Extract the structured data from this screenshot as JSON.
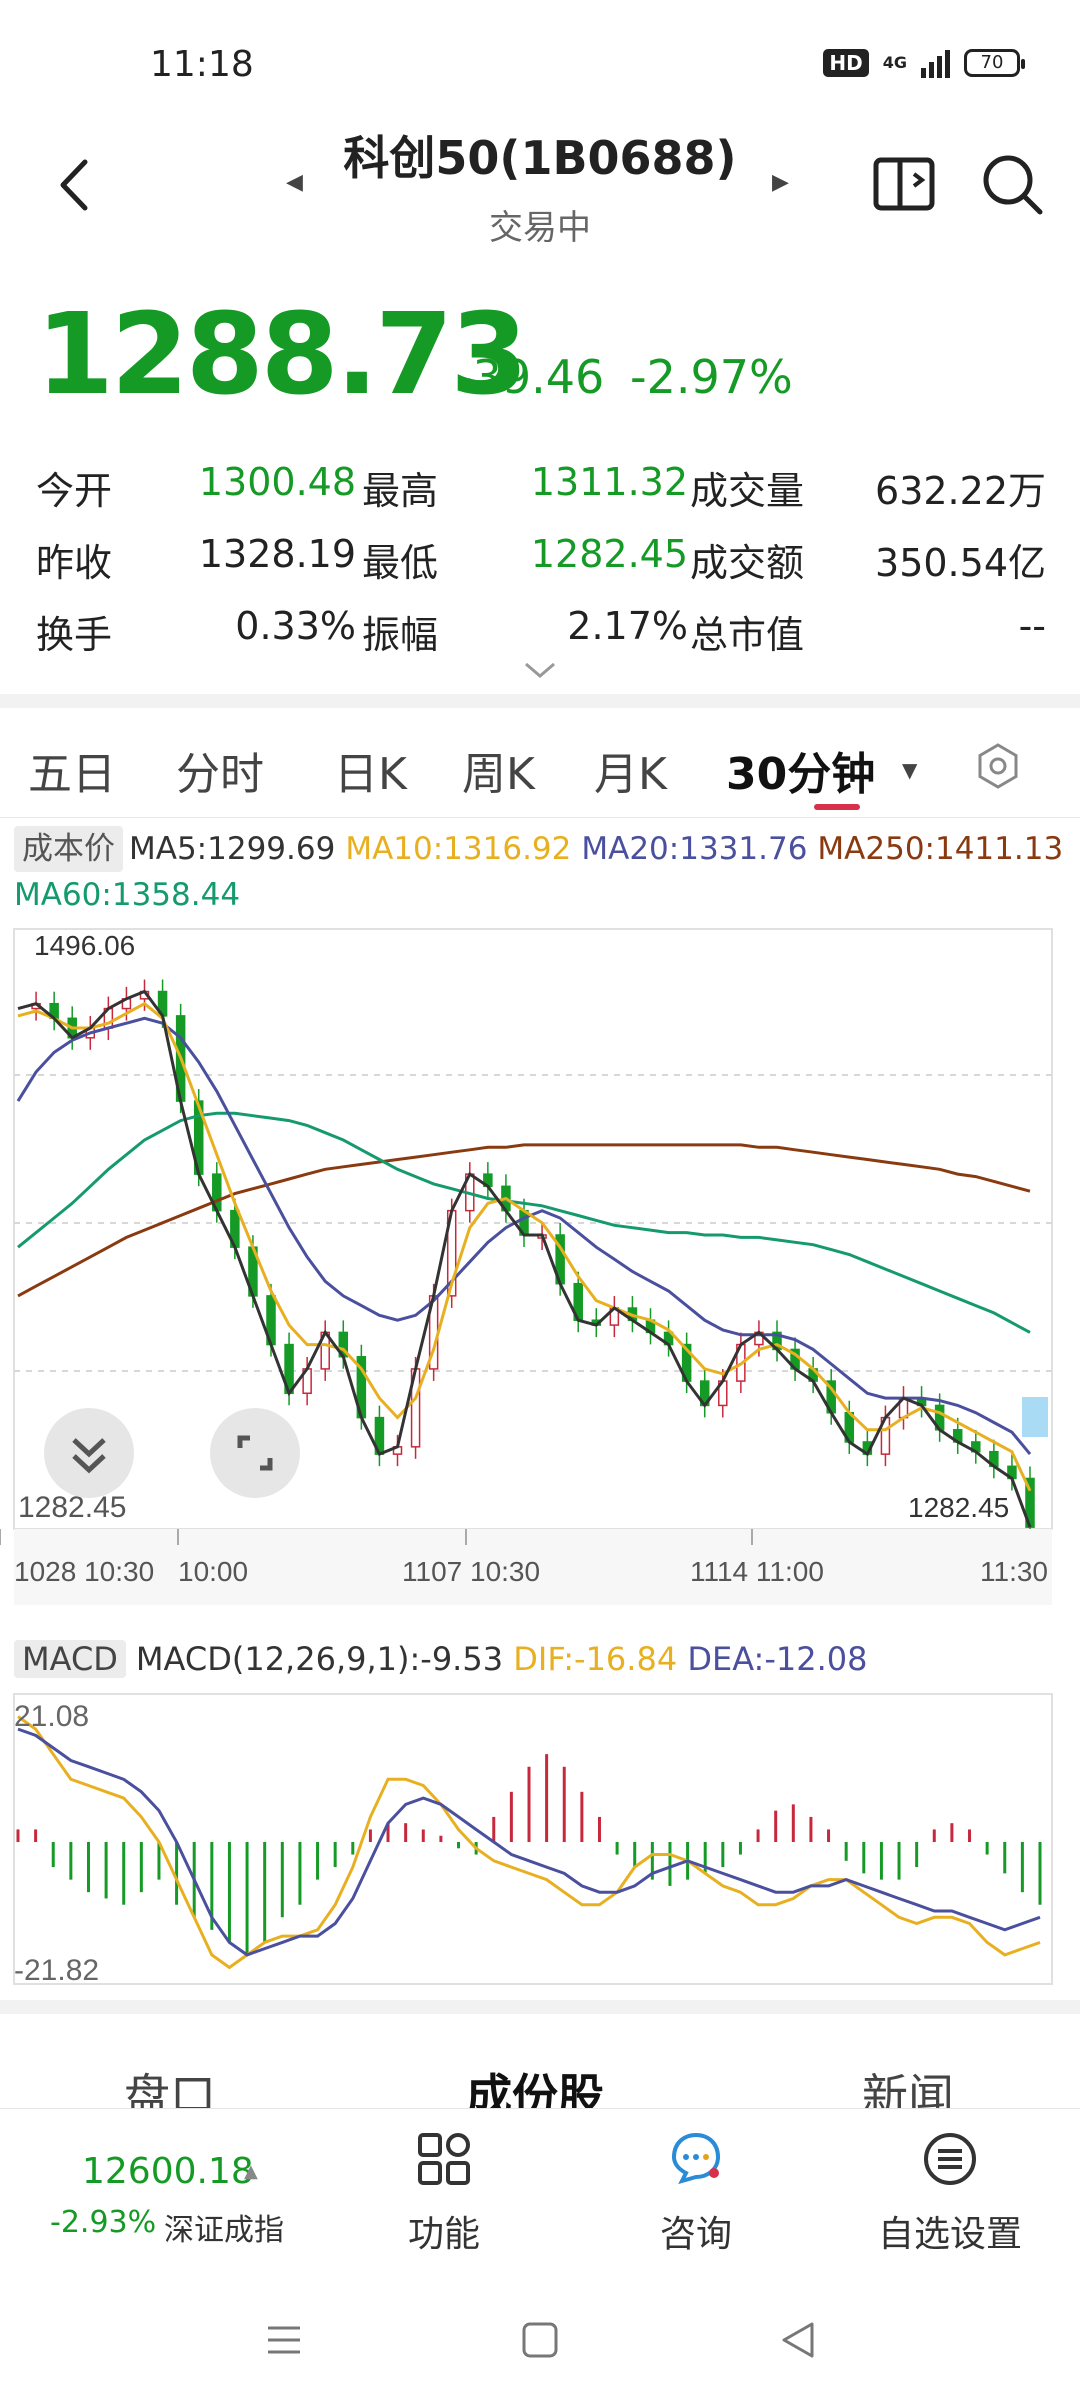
{
  "status_bar": {
    "time": "11:18",
    "hd": "HD",
    "network": "4G",
    "battery": "70"
  },
  "header": {
    "title": "科创50(1B0688)",
    "subtitle": "交易中"
  },
  "quote": {
    "price": "1288.73",
    "change": "-39.46",
    "change_pct": "-2.97%"
  },
  "stats": [
    {
      "l1": "今开",
      "v1": "1300.48",
      "l2": "最高",
      "v2": "1311.32",
      "l3": "成交量",
      "v3": "632.22万"
    },
    {
      "l1": "昨收",
      "v1": "1328.19",
      "l2": "最低",
      "v2": "1282.45",
      "l3": "成交额",
      "v3": "350.54亿"
    },
    {
      "l1": "换手",
      "v1": "0.33%",
      "l2": "振幅",
      "v2": "2.17%",
      "l3": "总市值",
      "v3": "--"
    }
  ],
  "tabs": [
    "五日",
    "分时",
    "日K",
    "周K",
    "月K",
    "30分钟"
  ],
  "legend": {
    "cost_label": "成本价",
    "ma5": "MA5:1299.69",
    "ma10": "MA10:1316.92",
    "ma20": "MA20:1331.76",
    "ma250": "MA250:1411.13",
    "ma60": "MA60:1358.44"
  },
  "colors": {
    "down": "#159a26",
    "up": "#c8283c",
    "ma5": "#333333",
    "ma10": "#e8b020",
    "ma20": "#4a4f9e",
    "ma60": "#159a6e",
    "ma250": "#8a3a10"
  },
  "chart_data": [
    {
      "type": "line",
      "title": "",
      "x_labels": [
        "1028 10:30",
        "10:00",
        "1107 10:30",
        "1114 11:00",
        "11:30"
      ],
      "max_label": "1496.06",
      "min_label": "1282.45",
      "left_low_label": "1282.45",
      "ylim": [
        1270,
        1500
      ],
      "series": [
        {
          "name": "MA5",
          "values": [
            1478,
            1480,
            1474,
            1466,
            1470,
            1478,
            1482,
            1485,
            1475,
            1440,
            1410,
            1395,
            1380,
            1360,
            1340,
            1320,
            1330,
            1345,
            1335,
            1310,
            1295,
            1298,
            1330,
            1360,
            1395,
            1410,
            1405,
            1395,
            1385,
            1385,
            1365,
            1350,
            1348,
            1355,
            1350,
            1345,
            1340,
            1325,
            1315,
            1325,
            1340,
            1345,
            1338,
            1330,
            1325,
            1312,
            1300,
            1295,
            1310,
            1318,
            1315,
            1305,
            1300,
            1296,
            1290,
            1285,
            1265
          ]
        },
        {
          "name": "MA10",
          "values": [
            1475,
            1477,
            1474,
            1470,
            1470,
            1472,
            1476,
            1480,
            1474,
            1458,
            1438,
            1418,
            1398,
            1380,
            1362,
            1348,
            1340,
            1340,
            1338,
            1330,
            1318,
            1310,
            1318,
            1338,
            1365,
            1388,
            1398,
            1400,
            1395,
            1390,
            1380,
            1368,
            1358,
            1355,
            1352,
            1350,
            1346,
            1338,
            1330,
            1328,
            1332,
            1338,
            1340,
            1336,
            1330,
            1322,
            1312,
            1305,
            1305,
            1310,
            1314,
            1312,
            1308,
            1304,
            1300,
            1296,
            1280
          ]
        },
        {
          "name": "MA20",
          "values": [
            1440,
            1452,
            1460,
            1465,
            1468,
            1470,
            1472,
            1474,
            1472,
            1466,
            1456,
            1444,
            1430,
            1416,
            1402,
            1388,
            1376,
            1366,
            1360,
            1356,
            1352,
            1350,
            1352,
            1358,
            1366,
            1374,
            1382,
            1388,
            1392,
            1395,
            1392,
            1386,
            1380,
            1375,
            1370,
            1366,
            1362,
            1356,
            1350,
            1346,
            1344,
            1344,
            1344,
            1342,
            1338,
            1332,
            1326,
            1320,
            1318,
            1318,
            1318,
            1317,
            1315,
            1312,
            1308,
            1304,
            1295
          ]
        },
        {
          "name": "MA60",
          "values": [
            1380,
            1386,
            1392,
            1398,
            1405,
            1412,
            1418,
            1424,
            1428,
            1432,
            1434,
            1435,
            1435,
            1434,
            1433,
            1432,
            1430,
            1427,
            1424,
            1420,
            1416,
            1412,
            1409,
            1406,
            1404,
            1402,
            1400,
            1399,
            1398,
            1397,
            1395,
            1393,
            1391,
            1389,
            1388,
            1387,
            1386,
            1386,
            1385,
            1385,
            1384,
            1384,
            1383,
            1382,
            1381,
            1379,
            1377,
            1374,
            1371,
            1368,
            1365,
            1362,
            1359,
            1356,
            1353,
            1349,
            1345
          ]
        },
        {
          "name": "MA250",
          "values": [
            1360,
            1364,
            1368,
            1372,
            1376,
            1380,
            1384,
            1387,
            1390,
            1393,
            1396,
            1399,
            1402,
            1404,
            1406,
            1408,
            1410,
            1412,
            1413,
            1414,
            1415,
            1416,
            1417,
            1418,
            1419,
            1420,
            1421,
            1421,
            1422,
            1422,
            1422,
            1422,
            1422,
            1422,
            1422,
            1422,
            1422,
            1422,
            1422,
            1422,
            1422,
            1421,
            1421,
            1420,
            1419,
            1418,
            1417,
            1416,
            1415,
            1414,
            1413,
            1412,
            1410,
            1409,
            1407,
            1405,
            1403
          ]
        }
      ]
    },
    {
      "type": "bar",
      "title": "",
      "y_top_label": "21.08",
      "y_bottom_label": "-21.82",
      "ylim": [
        -22,
        22
      ],
      "histogram": [
        2,
        2,
        -4,
        -6,
        -8,
        -9,
        -10,
        -8,
        -6,
        -10,
        -12,
        -14,
        -16,
        -18,
        -16,
        -12,
        -10,
        -6,
        -4,
        -2,
        2,
        3,
        3,
        2,
        1,
        -1,
        -2,
        4,
        8,
        12,
        14,
        12,
        8,
        4,
        -2,
        -4,
        -6,
        -7,
        -6,
        -5,
        -4,
        -2,
        2,
        5,
        6,
        4,
        2,
        -3,
        -5,
        -6,
        -6,
        -4,
        2,
        3,
        2,
        -2,
        -5,
        -8,
        -10
      ],
      "series": [
        {
          "name": "DIF",
          "values": [
            20,
            18,
            14,
            10,
            9,
            8,
            7,
            4,
            0,
            -6,
            -12,
            -18,
            -20,
            -18,
            -16,
            -15,
            -15,
            -14,
            -10,
            -4,
            4,
            10,
            10,
            9,
            6,
            2,
            -1,
            -3,
            -4,
            -5,
            -6,
            -8,
            -10,
            -10,
            -8,
            -4,
            -2,
            -2,
            -3,
            -5,
            -7,
            -8,
            -10,
            -10,
            -9,
            -7,
            -6,
            -6,
            -8,
            -10,
            -12,
            -13,
            -12,
            -12,
            -13,
            -16,
            -18,
            -17,
            -16
          ]
        },
        {
          "name": "DEA",
          "values": [
            18,
            17,
            15,
            13,
            12,
            11,
            10,
            8,
            5,
            0,
            -6,
            -12,
            -16,
            -18,
            -17,
            -16,
            -15,
            -15,
            -13,
            -9,
            -3,
            3,
            6,
            7,
            6,
            4,
            2,
            0,
            -2,
            -3,
            -4,
            -5,
            -7,
            -8,
            -8,
            -7,
            -5,
            -4,
            -3,
            -4,
            -5,
            -6,
            -7,
            -8,
            -8,
            -7,
            -7,
            -6,
            -7,
            -8,
            -9,
            -10,
            -11,
            -11,
            -12,
            -13,
            -14,
            -13,
            -12
          ]
        }
      ],
      "legend": {
        "selector": "MACD",
        "macd": "MACD(12,26,9,1):-9.53",
        "dif": "DIF:-16.84",
        "dea": "DEA:-12.08"
      }
    }
  ],
  "sub_tabs": [
    "盘口",
    "成份股",
    "新闻"
  ],
  "bottom_bar": {
    "index_value": "12600.18",
    "index_pct": "-2.93%",
    "index_name": "深证成指",
    "items": [
      "功能",
      "咨询",
      "自选设置"
    ]
  }
}
